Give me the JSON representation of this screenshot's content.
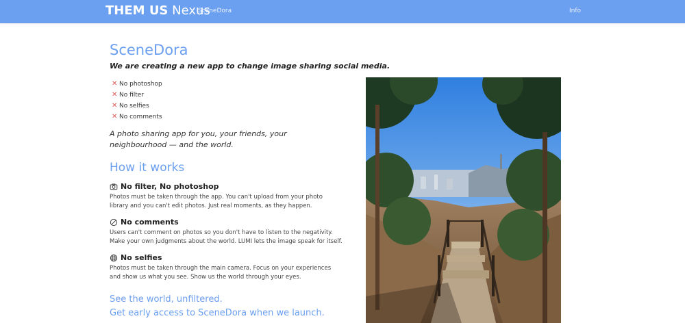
{
  "nav": {
    "brand_bold": "THEM US",
    "brand_light": "Nexus",
    "link_scenedora": "SceneDora",
    "link_info": "Info"
  },
  "main": {
    "title": "SceneDora",
    "tagline": "We are creating a new app to change image sharing social media.",
    "no_items": [
      "No photoshop",
      "No filter",
      "No selfies",
      "No comments"
    ],
    "lead": "A photo sharing app for you, your friends, your neighbourhood — and the world.",
    "how_title": "How it works",
    "features": [
      {
        "title": "No filter, No photoshop",
        "icon": "camera-icon",
        "text": "Photos must be taken through the app. You can't upload from your photo library and you can't edit photos. Just real moments, as they happen."
      },
      {
        "title": "No comments",
        "icon": "no-symbol-icon",
        "text": "Users can't comment on photos so you don't have to listen to the negativity. Make your own judgments about the world. LUMI lets the image speak for itself."
      },
      {
        "title": "No selfies",
        "icon": "globe-icon",
        "text": "Photos must be taken through the main camera. Focus on your experiences and show us what you see. Show us the world through your eyes."
      }
    ],
    "cta_line1": "See the world, unfiltered.",
    "cta_line2": "Get early access to SceneDora when we launch."
  },
  "colors": {
    "accent": "#6b9ff0",
    "navbar": "#6b9ff0",
    "x_mark": "#e05555"
  }
}
